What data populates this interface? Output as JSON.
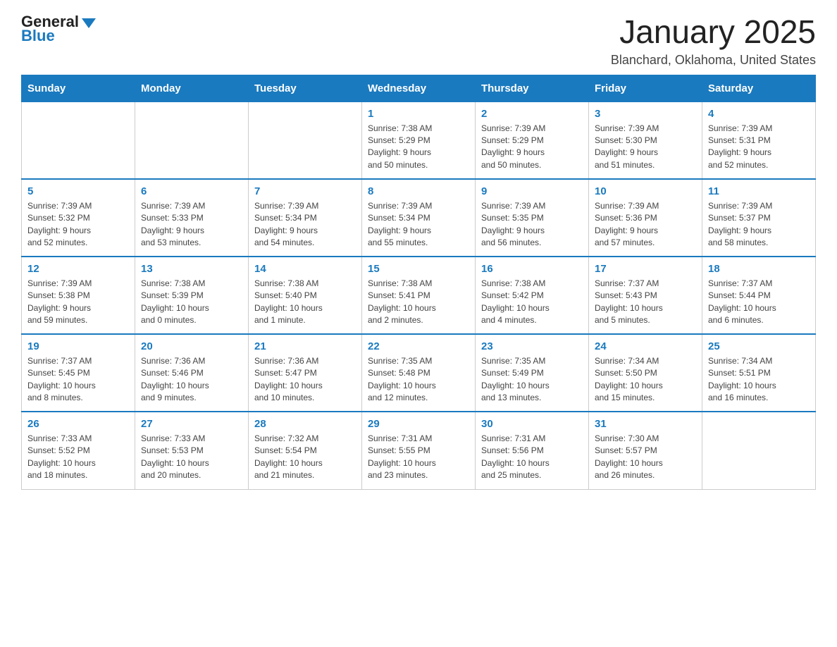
{
  "header": {
    "logo_general": "General",
    "logo_blue": "Blue",
    "title": "January 2025",
    "location": "Blanchard, Oklahoma, United States"
  },
  "weekdays": [
    "Sunday",
    "Monday",
    "Tuesday",
    "Wednesday",
    "Thursday",
    "Friday",
    "Saturday"
  ],
  "weeks": [
    [
      {
        "day": "",
        "info": ""
      },
      {
        "day": "",
        "info": ""
      },
      {
        "day": "",
        "info": ""
      },
      {
        "day": "1",
        "info": "Sunrise: 7:38 AM\nSunset: 5:29 PM\nDaylight: 9 hours\nand 50 minutes."
      },
      {
        "day": "2",
        "info": "Sunrise: 7:39 AM\nSunset: 5:29 PM\nDaylight: 9 hours\nand 50 minutes."
      },
      {
        "day": "3",
        "info": "Sunrise: 7:39 AM\nSunset: 5:30 PM\nDaylight: 9 hours\nand 51 minutes."
      },
      {
        "day": "4",
        "info": "Sunrise: 7:39 AM\nSunset: 5:31 PM\nDaylight: 9 hours\nand 52 minutes."
      }
    ],
    [
      {
        "day": "5",
        "info": "Sunrise: 7:39 AM\nSunset: 5:32 PM\nDaylight: 9 hours\nand 52 minutes."
      },
      {
        "day": "6",
        "info": "Sunrise: 7:39 AM\nSunset: 5:33 PM\nDaylight: 9 hours\nand 53 minutes."
      },
      {
        "day": "7",
        "info": "Sunrise: 7:39 AM\nSunset: 5:34 PM\nDaylight: 9 hours\nand 54 minutes."
      },
      {
        "day": "8",
        "info": "Sunrise: 7:39 AM\nSunset: 5:34 PM\nDaylight: 9 hours\nand 55 minutes."
      },
      {
        "day": "9",
        "info": "Sunrise: 7:39 AM\nSunset: 5:35 PM\nDaylight: 9 hours\nand 56 minutes."
      },
      {
        "day": "10",
        "info": "Sunrise: 7:39 AM\nSunset: 5:36 PM\nDaylight: 9 hours\nand 57 minutes."
      },
      {
        "day": "11",
        "info": "Sunrise: 7:39 AM\nSunset: 5:37 PM\nDaylight: 9 hours\nand 58 minutes."
      }
    ],
    [
      {
        "day": "12",
        "info": "Sunrise: 7:39 AM\nSunset: 5:38 PM\nDaylight: 9 hours\nand 59 minutes."
      },
      {
        "day": "13",
        "info": "Sunrise: 7:38 AM\nSunset: 5:39 PM\nDaylight: 10 hours\nand 0 minutes."
      },
      {
        "day": "14",
        "info": "Sunrise: 7:38 AM\nSunset: 5:40 PM\nDaylight: 10 hours\nand 1 minute."
      },
      {
        "day": "15",
        "info": "Sunrise: 7:38 AM\nSunset: 5:41 PM\nDaylight: 10 hours\nand 2 minutes."
      },
      {
        "day": "16",
        "info": "Sunrise: 7:38 AM\nSunset: 5:42 PM\nDaylight: 10 hours\nand 4 minutes."
      },
      {
        "day": "17",
        "info": "Sunrise: 7:37 AM\nSunset: 5:43 PM\nDaylight: 10 hours\nand 5 minutes."
      },
      {
        "day": "18",
        "info": "Sunrise: 7:37 AM\nSunset: 5:44 PM\nDaylight: 10 hours\nand 6 minutes."
      }
    ],
    [
      {
        "day": "19",
        "info": "Sunrise: 7:37 AM\nSunset: 5:45 PM\nDaylight: 10 hours\nand 8 minutes."
      },
      {
        "day": "20",
        "info": "Sunrise: 7:36 AM\nSunset: 5:46 PM\nDaylight: 10 hours\nand 9 minutes."
      },
      {
        "day": "21",
        "info": "Sunrise: 7:36 AM\nSunset: 5:47 PM\nDaylight: 10 hours\nand 10 minutes."
      },
      {
        "day": "22",
        "info": "Sunrise: 7:35 AM\nSunset: 5:48 PM\nDaylight: 10 hours\nand 12 minutes."
      },
      {
        "day": "23",
        "info": "Sunrise: 7:35 AM\nSunset: 5:49 PM\nDaylight: 10 hours\nand 13 minutes."
      },
      {
        "day": "24",
        "info": "Sunrise: 7:34 AM\nSunset: 5:50 PM\nDaylight: 10 hours\nand 15 minutes."
      },
      {
        "day": "25",
        "info": "Sunrise: 7:34 AM\nSunset: 5:51 PM\nDaylight: 10 hours\nand 16 minutes."
      }
    ],
    [
      {
        "day": "26",
        "info": "Sunrise: 7:33 AM\nSunset: 5:52 PM\nDaylight: 10 hours\nand 18 minutes."
      },
      {
        "day": "27",
        "info": "Sunrise: 7:33 AM\nSunset: 5:53 PM\nDaylight: 10 hours\nand 20 minutes."
      },
      {
        "day": "28",
        "info": "Sunrise: 7:32 AM\nSunset: 5:54 PM\nDaylight: 10 hours\nand 21 minutes."
      },
      {
        "day": "29",
        "info": "Sunrise: 7:31 AM\nSunset: 5:55 PM\nDaylight: 10 hours\nand 23 minutes."
      },
      {
        "day": "30",
        "info": "Sunrise: 7:31 AM\nSunset: 5:56 PM\nDaylight: 10 hours\nand 25 minutes."
      },
      {
        "day": "31",
        "info": "Sunrise: 7:30 AM\nSunset: 5:57 PM\nDaylight: 10 hours\nand 26 minutes."
      },
      {
        "day": "",
        "info": ""
      }
    ]
  ]
}
